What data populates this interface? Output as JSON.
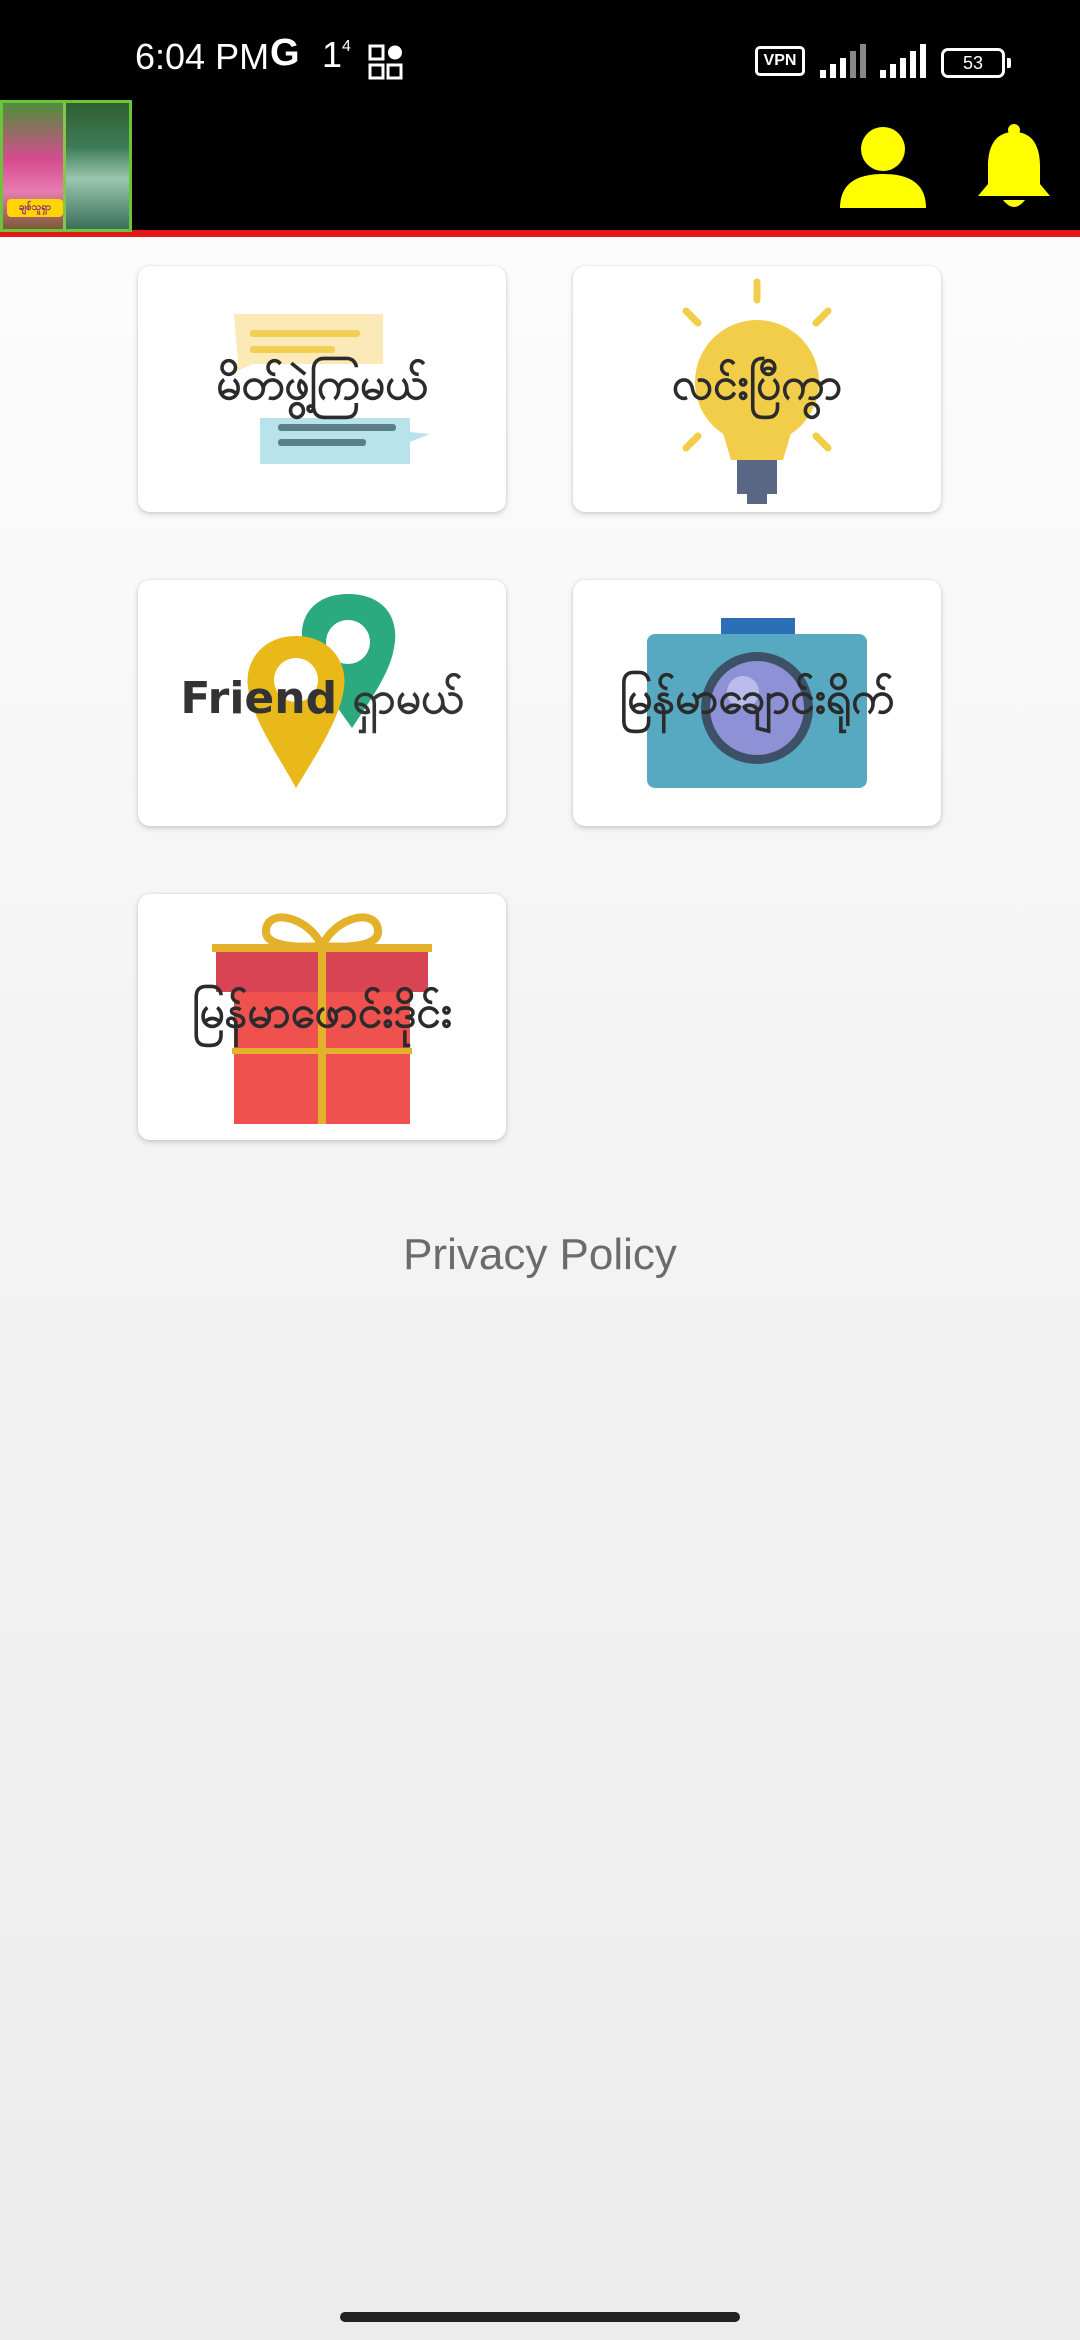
{
  "status_bar": {
    "time": "6:04 PM",
    "network_glyph": "G",
    "notification_count": "1",
    "notification_sup": "4",
    "vpn_label": "VPN",
    "battery_level": "53",
    "icons": [
      "google-icon",
      "apps-icon",
      "signal-icon",
      "signal-icon",
      "battery-icon"
    ]
  },
  "app_bar": {
    "logo_caption": "ချစ်သူရှာ",
    "icons": [
      "profile-icon",
      "bell-icon"
    ],
    "accent_color": "#FFFF00",
    "divider_color": "#E31818"
  },
  "menu": {
    "items": [
      {
        "label": "မိတ်ဖွဲ့ကြမယ်",
        "icon": "chat-bubbles-icon"
      },
      {
        "label": "လင်းပြီကွာ",
        "icon": "lightbulb-icon"
      },
      {
        "label": "Friend ရှာမယ်",
        "icon": "location-pins-icon"
      },
      {
        "label": "မြန်မာချောင်းရိုက်",
        "icon": "camera-icon"
      },
      {
        "label": "မြန်မာဖောင်းဒိုင်း",
        "icon": "gift-icon"
      }
    ]
  },
  "footer": {
    "privacy_label": "Privacy Policy"
  }
}
